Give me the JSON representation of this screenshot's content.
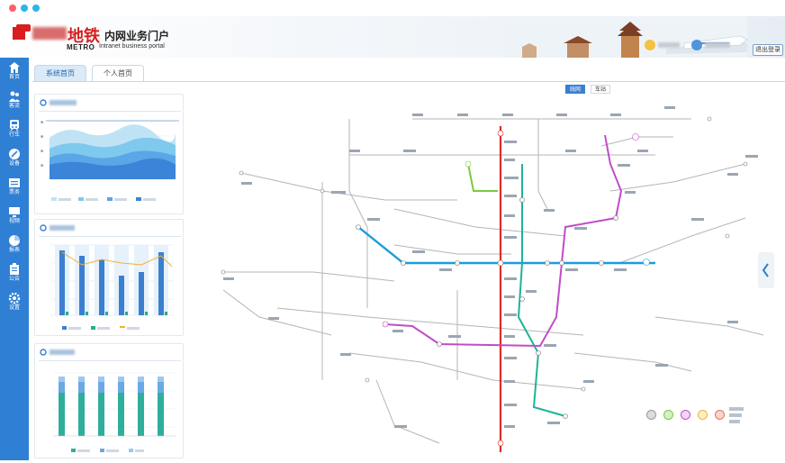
{
  "header": {
    "logo_big": "地铁",
    "logo_title": "内网业务门户",
    "logo_metro": "METRO",
    "logo_sub": "Intranet business portal",
    "logout": "退出登录"
  },
  "sidebar": {
    "items": [
      {
        "label": "首页",
        "icon": "home-icon"
      },
      {
        "label": "客流",
        "icon": "users-icon"
      },
      {
        "label": "行车",
        "icon": "train-icon"
      },
      {
        "label": "设备",
        "icon": "tools-icon"
      },
      {
        "label": "票务",
        "icon": "ticket-icon"
      },
      {
        "label": "视频",
        "icon": "monitor-icon"
      },
      {
        "label": "报表",
        "icon": "pie-icon"
      },
      {
        "label": "公告",
        "icon": "notice-icon"
      },
      {
        "label": "设置",
        "icon": "gear-icon"
      }
    ]
  },
  "tabs": [
    {
      "label": "系统首页",
      "active": true
    },
    {
      "label": "个人首页",
      "active": false
    }
  ],
  "map": {
    "toggle": [
      "线网",
      "车站"
    ]
  },
  "colors": {
    "sidebar": "#2f7fd4",
    "line_red": "#e02b2b",
    "line_blue": "#1a9de0",
    "line_purple": "#c04cc8",
    "line_teal": "#1db39a",
    "line_green": "#7ac943"
  }
}
